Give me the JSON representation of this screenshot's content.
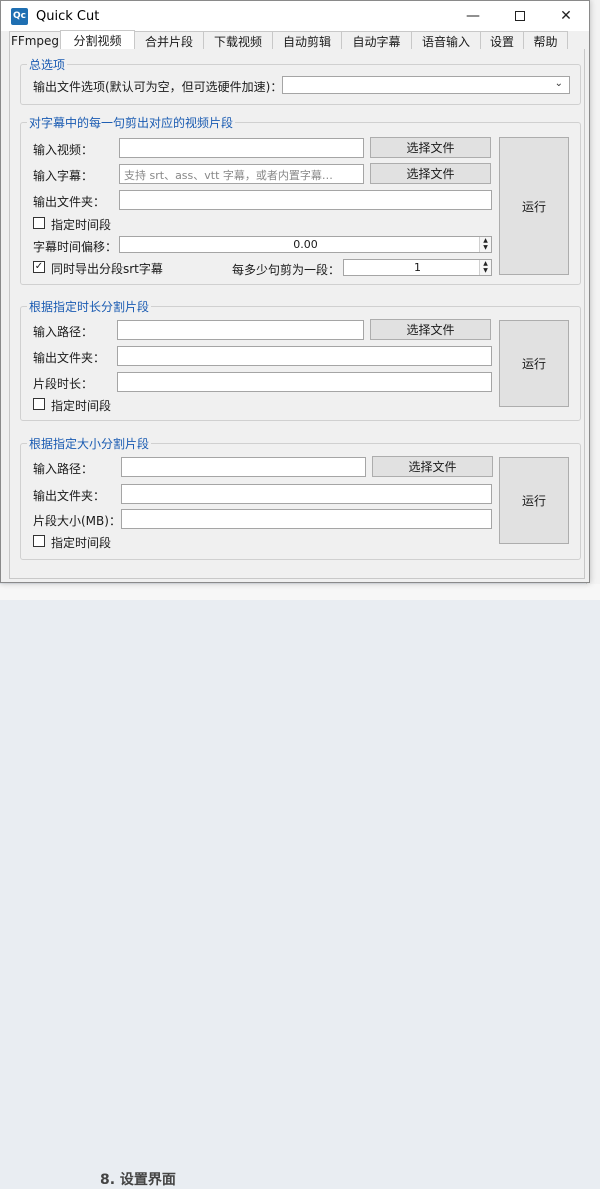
{
  "window": {
    "title": "Quick Cut",
    "app_icon": "Qc"
  },
  "tabs": [
    "FFmpeg",
    "分割视频",
    "合并片段",
    "下载视频",
    "自动剪辑",
    "自动字幕",
    "语音输入",
    "设置",
    "帮助"
  ],
  "active_tab": "分割视频",
  "general": {
    "title": "总选项",
    "output_option_label": "输出文件选项(默认可为空，但可选硬件加速)：",
    "output_option_value": ""
  },
  "subtitle_cut": {
    "title": "对字幕中的每一句剪出对应的视频片段",
    "input_video_label": "输入视频：",
    "input_video_value": "",
    "input_subtitle_label": "输入字幕：",
    "input_subtitle_placeholder": "支持 srt、ass、vtt 字幕，或者内置字幕…",
    "output_folder_label": "输出文件夹：",
    "output_folder_value": "",
    "select_file_label": "选择文件",
    "specify_time_label": "指定时间段",
    "specify_time_checked": false,
    "offset_label": "字幕时间偏移：",
    "offset_value": "0.00",
    "export_srt_label": "同时导出分段srt字幕",
    "export_srt_checked": true,
    "per_segment_label": "每多少句剪为一段：",
    "per_segment_value": "1",
    "run_label": "运行"
  },
  "duration_cut": {
    "title": "根据指定时长分割片段",
    "input_path_label": "输入路径：",
    "output_folder_label": "输出文件夹：",
    "duration_label": "片段时长：",
    "select_file_label": "选择文件",
    "specify_time_label": "指定时间段",
    "specify_time_checked": false,
    "run_label": "运行"
  },
  "size_cut": {
    "title": "根据指定大小分割片段",
    "input_path_label": "输入路径：",
    "output_folder_label": "输出文件夹：",
    "size_label": "片段大小(MB)：",
    "select_file_label": "选择文件",
    "specify_time_label": "指定时间段",
    "specify_time_checked": false,
    "run_label": "运行"
  },
  "background": {
    "bottom_text": "8. 设置界面"
  }
}
